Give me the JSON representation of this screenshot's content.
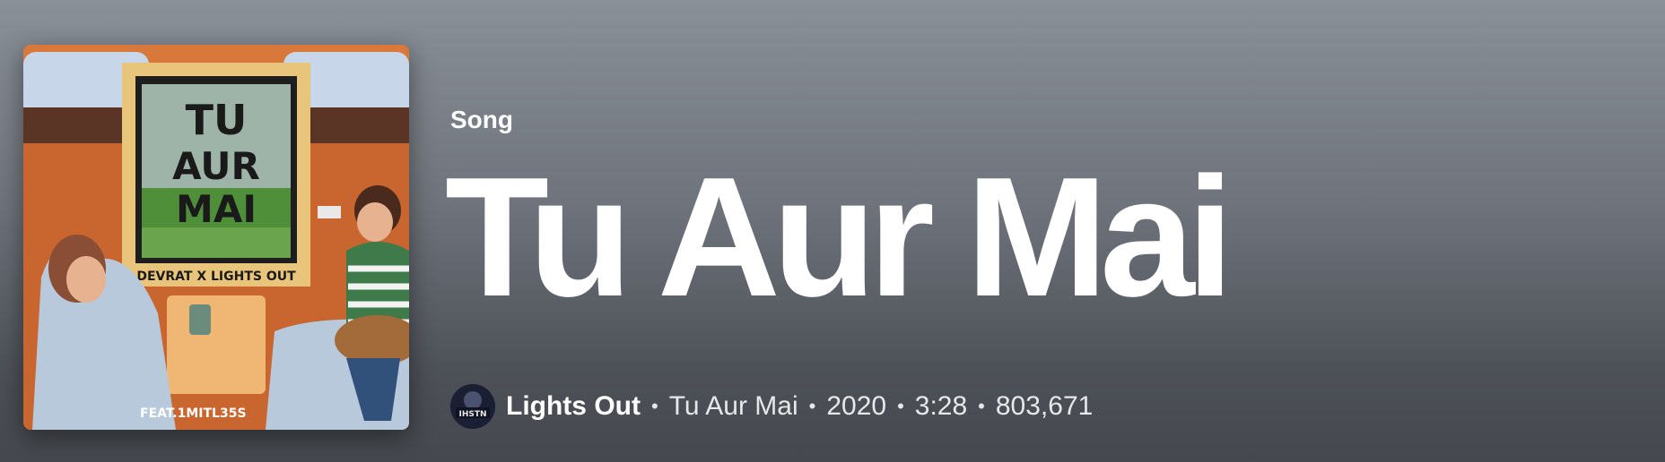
{
  "song": {
    "type_label": "Song",
    "title": "Tu Aur Mai",
    "artist": "Lights Out",
    "album": "Tu Aur Mai",
    "year": "2020",
    "duration": "3:28",
    "play_count": "803,671",
    "separator": "•"
  },
  "cover_art": {
    "title_line_1": "TU",
    "title_line_2": "AUR",
    "title_line_3": "MAI",
    "credits": "DEVRAT X LIGHTS OUT",
    "feat": "FEAT.1MITL35S"
  },
  "avatar_text": "IHSTN",
  "colors": {
    "bg_top": "#8a9098",
    "bg_bottom": "#45484e",
    "text": "#ffffff",
    "meta_text": "#e6e8ea"
  }
}
